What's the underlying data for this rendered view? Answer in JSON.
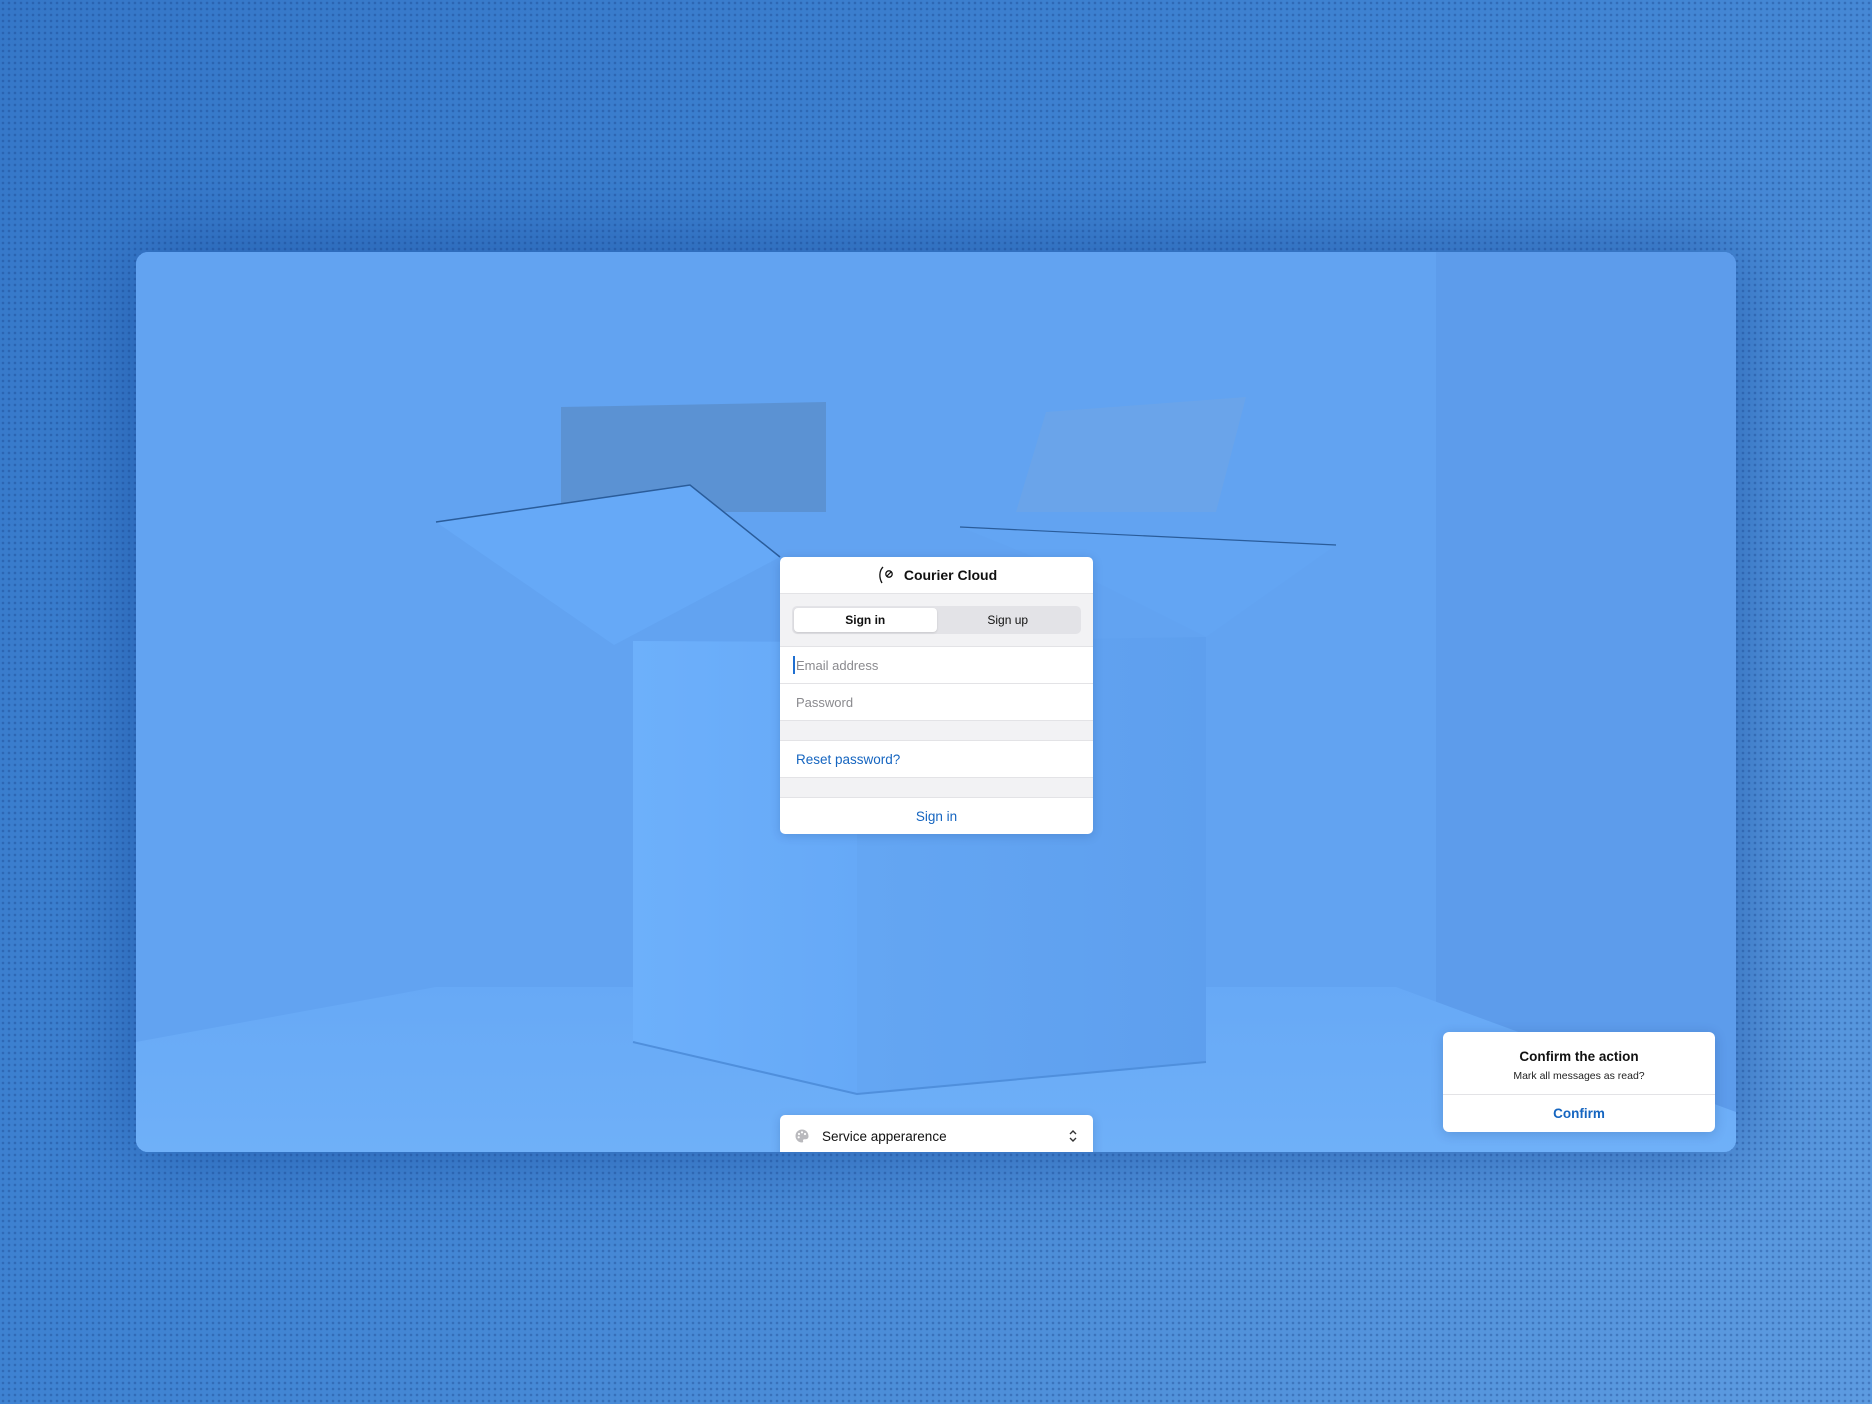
{
  "app": {
    "title": "Courier Cloud"
  },
  "auth_tabs": [
    {
      "label": "Sign in",
      "active": true
    },
    {
      "label": "Sign up",
      "active": false
    }
  ],
  "form": {
    "email_placeholder": "Email address",
    "email_value": "",
    "password_placeholder": "Password",
    "password_value": "",
    "reset_link": "Reset password?",
    "submit_label": "Sign in"
  },
  "appearance": {
    "label": "Service apperarence"
  },
  "toast": {
    "title": "Confirm the action",
    "message": "Mark all messages as read?",
    "action_label": "Confirm"
  },
  "colors": {
    "background": "#3d7fcf",
    "screen": "#66a8f5",
    "accent": "#1565c0",
    "card": "#ffffff"
  },
  "icons": {
    "logo": "feather-pen-logo-icon",
    "appearance": "palette-icon",
    "appearance_chevron": "chevron-up-down-icon"
  }
}
